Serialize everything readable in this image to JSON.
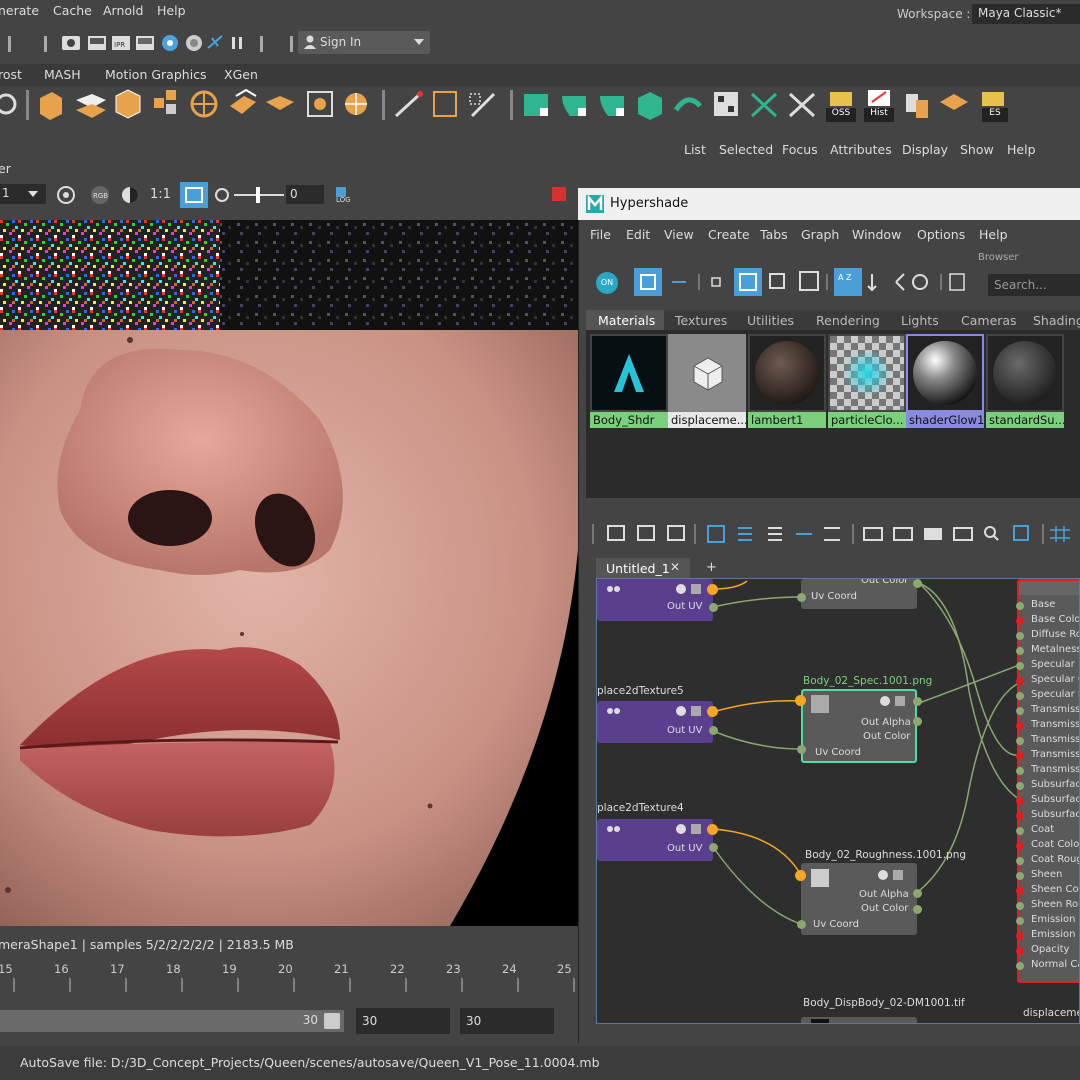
{
  "menubar": {
    "items": [
      "nerate",
      "Cache",
      "Arnold",
      "Help"
    ],
    "workspace_label": "Workspace :",
    "workspace_value": "Maya Classic*"
  },
  "statusline": {
    "signin_label": "Sign In"
  },
  "shelf": {
    "tabs": [
      "rost",
      "MASH",
      "Motion Graphics",
      "XGen"
    ],
    "labels": {
      "oss": "OSS",
      "hist": "Hist",
      "es": "ES"
    }
  },
  "outliner": {
    "menu": [
      "List",
      "Selected",
      "Focus",
      "Attributes",
      "Display",
      "Show",
      "Help"
    ]
  },
  "renderview": {
    "header": "er",
    "frame_field": "1",
    "ratio": "1:1",
    "exposure_value": "0",
    "log_label": "LOG",
    "info": "meraShape1  |  samples 5/2/2/2/2/2  |  2183.5 MB"
  },
  "timeline": {
    "ticks": [
      "15",
      "16",
      "17",
      "18",
      "19",
      "20",
      "21",
      "22",
      "23",
      "24",
      "25"
    ],
    "range_end": "30",
    "field_1": "30",
    "field_2": "30"
  },
  "helpline": {
    "text": "AutoSave file: D:/3D_Concept_Projects/Queen/scenes/autosave/Queen_V1_Pose_11.0004.mb"
  },
  "hypershade": {
    "title": "Hypershade",
    "menu": [
      "File",
      "Edit",
      "View",
      "Create",
      "Tabs",
      "Graph",
      "Window",
      "Options",
      "Help"
    ],
    "browser_label": "Browser",
    "search_placeholder": "Search...",
    "on_label": "ON",
    "tabs": [
      "Materials",
      "Textures",
      "Utilities",
      "Rendering",
      "Lights",
      "Cameras",
      "Shading"
    ],
    "swatches": [
      "Body_Shdr",
      "displaceme...",
      "lambert1",
      "particleClo...",
      "shaderGlow1",
      "standardSu..."
    ],
    "graph_tab": "Untitled_1",
    "graph_tab_close": "✕",
    "graph_tab_add": "+"
  },
  "graph": {
    "nodes": {
      "place_top": {
        "out_uv": "Out UV"
      },
      "place5": {
        "title": "place2dTexture5",
        "out_uv": "Out UV"
      },
      "place4": {
        "title": "place2dTexture4",
        "out_uv": "Out UV"
      },
      "tex_top": {
        "out_color": "Out Color",
        "uv": "Uv Coord"
      },
      "spec": {
        "title": "Body_02_Spec.1001.png",
        "out_alpha": "Out Alpha",
        "out_color": "Out Color",
        "uv": "Uv Coord"
      },
      "rough": {
        "title": "Body_02_Roughness.1001.png",
        "out_alpha": "Out Alpha",
        "out_color": "Out Color",
        "uv": "Uv Coord"
      },
      "disp": {
        "title": "Body_DispBody_02-DM1001.tif"
      },
      "displacement_label": "displacemen"
    },
    "shader_attrs": [
      "Base",
      "Base Color",
      "Diffuse Rou",
      "Metalness",
      "Specular",
      "Specular Co",
      "Specular Ro",
      "Transmissio",
      "Transmissio",
      "Transmissio",
      "Transmissio",
      "Transmissio",
      "Subsurface",
      "Subsurface",
      "Subsurface",
      "Coat",
      "Coat Color",
      "Coat Rough",
      "Sheen",
      "Sheen Colo",
      "Sheen Roug",
      "Emission",
      "Emission C",
      "Opacity",
      "Normal Car"
    ]
  },
  "colors": {
    "ui_bg": "#444444",
    "accent_blue": "#4a9fd8",
    "node_purple": "#5a3f8f",
    "swatch_green": "#7bd17b",
    "connection_orange": "#f5a623",
    "shader_red": "#e02020"
  }
}
